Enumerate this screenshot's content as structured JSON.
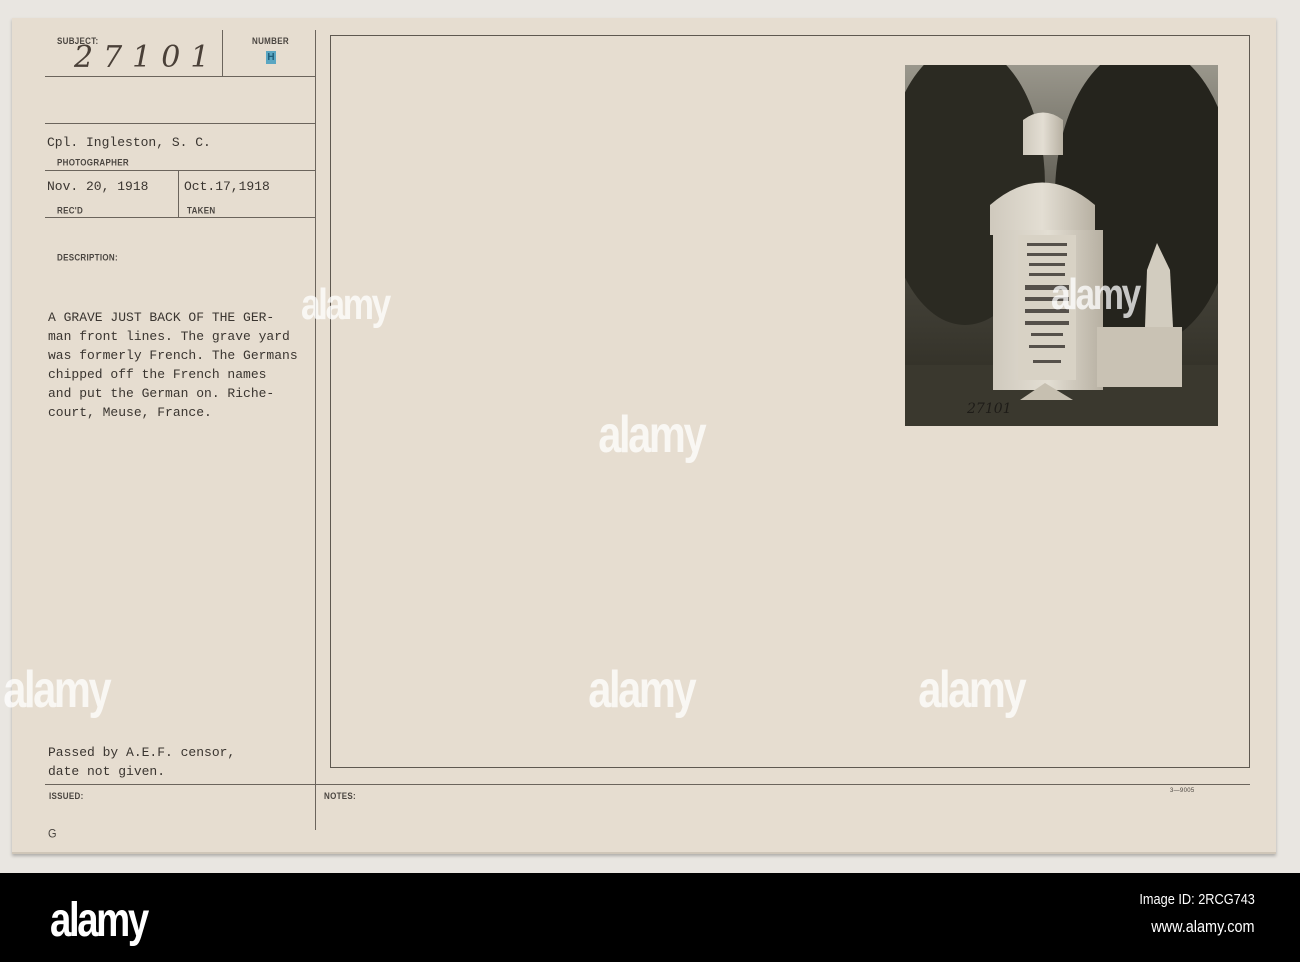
{
  "card": {
    "subject_label": "SUBJECT:",
    "subject_number": "27101",
    "number_label": "NUMBER",
    "number_stamp": "H",
    "photographer": "Cpl. Ingleston, S. C.",
    "photographer_label": "PHOTOGRAPHER",
    "received": "Nov. 20, 1918",
    "received_label": "REC'D",
    "taken": "Oct.17,1918",
    "taken_label": "TAKEN",
    "description_label": "DESCRIPTION:",
    "description_lines": [
      "A GRAVE JUST BACK OF THE GER-",
      "man front lines. The grave yard",
      "was formerly French. The Germans",
      "chipped off the French names",
      "and put the German on. Riche-",
      "court, Meuse, France."
    ],
    "censor_lines": [
      "Passed by A.E.F. censor,",
      "date not given."
    ],
    "issued_label": "ISSUED:",
    "notes_label": "NOTES:",
    "form_code": "3—9005",
    "corner_letter": "G",
    "photo_number": "27101"
  },
  "watermark": "alamy",
  "footer": {
    "logo": "alamy",
    "image_id": "Image ID: 2RCG743",
    "url": "www.alamy.com"
  }
}
